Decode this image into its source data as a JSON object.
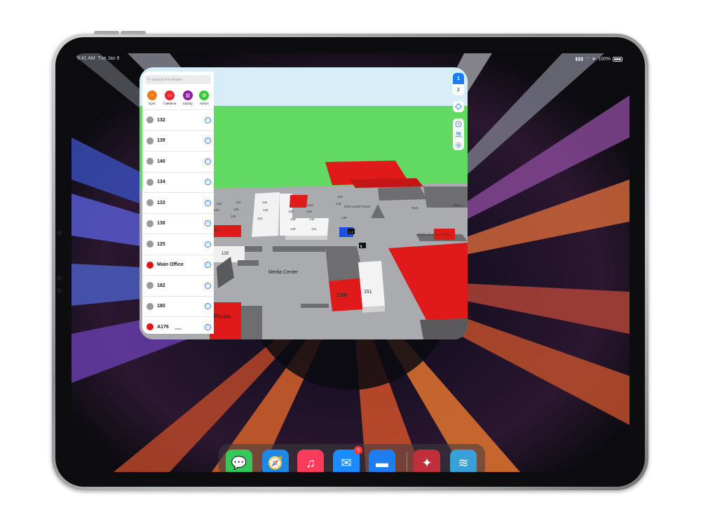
{
  "status_bar": {
    "time": "9:41 AM",
    "date": "Tue Jan 9",
    "battery": "100%"
  },
  "search": {
    "placeholder": "Search For Room"
  },
  "categories": [
    {
      "label": "Gym",
      "color": "#f07a1a",
      "icon": "gym-icon"
    },
    {
      "label": "Cafeteria",
      "color": "#e8262a",
      "icon": "cafeteria-icon"
    },
    {
      "label": "Library",
      "color": "#8a1fa3",
      "icon": "library-icon"
    },
    {
      "label": "Atrium",
      "color": "#33cc33",
      "icon": "atrium-icon"
    }
  ],
  "rooms": [
    {
      "label": "132",
      "color": "#9a9a9a"
    },
    {
      "label": "139",
      "color": "#9a9a9a"
    },
    {
      "label": "140",
      "color": "#9a9a9a"
    },
    {
      "label": "134",
      "color": "#9a9a9a"
    },
    {
      "label": "133",
      "color": "#9a9a9a"
    },
    {
      "label": "138",
      "color": "#9a9a9a"
    },
    {
      "label": "125",
      "color": "#9a9a9a"
    },
    {
      "label": "Main Office",
      "color": "#e11414"
    },
    {
      "label": "182",
      "color": "#9a9a9a"
    },
    {
      "label": "180",
      "color": "#9a9a9a"
    },
    {
      "label": "A176",
      "color": "#e11414"
    }
  ],
  "floors": [
    "1",
    "2"
  ],
  "active_floor": "1",
  "map": {
    "labels": {
      "media_center": "Media Center",
      "r1300": "1300",
      "r151": "151",
      "r129": "129",
      "r121": "121",
      "r120": "120",
      "r126": "126",
      "r137": "137",
      "r134": "134",
      "r133": "133",
      "r132": "132",
      "r125": "125",
      "r123": "23",
      "r139": "139",
      "r140": "140",
      "r143": "143",
      "r144a": "144A",
      "r142": "142",
      "r141": "141",
      "r146": "146",
      "r148": "148",
      "r149": "149",
      "gym": "Gym",
      "girls_locker": "Girls Locker Room",
      "boys": "Boys L",
      "athletic": "Athletic Director's Office",
      "office": "n Office",
      "room": "Room"
    }
  },
  "dock": {
    "apps": [
      {
        "name": "Messages",
        "icon": "messages-icon",
        "color": "#34c759"
      },
      {
        "name": "Safari",
        "icon": "safari-icon",
        "color": "#1e88e5"
      },
      {
        "name": "Music",
        "icon": "music-icon",
        "color": "#fa3c5a"
      },
      {
        "name": "Mail",
        "icon": "mail-icon",
        "color": "#1a8cff",
        "badge": "3"
      },
      {
        "name": "Files",
        "icon": "files-icon",
        "color": "#1e7df0"
      },
      {
        "name": "Compass",
        "icon": "compass-app-icon",
        "color": "#c0303a"
      },
      {
        "name": "Waves",
        "icon": "waves-app-icon",
        "color": "#3aa0d8"
      }
    ]
  }
}
